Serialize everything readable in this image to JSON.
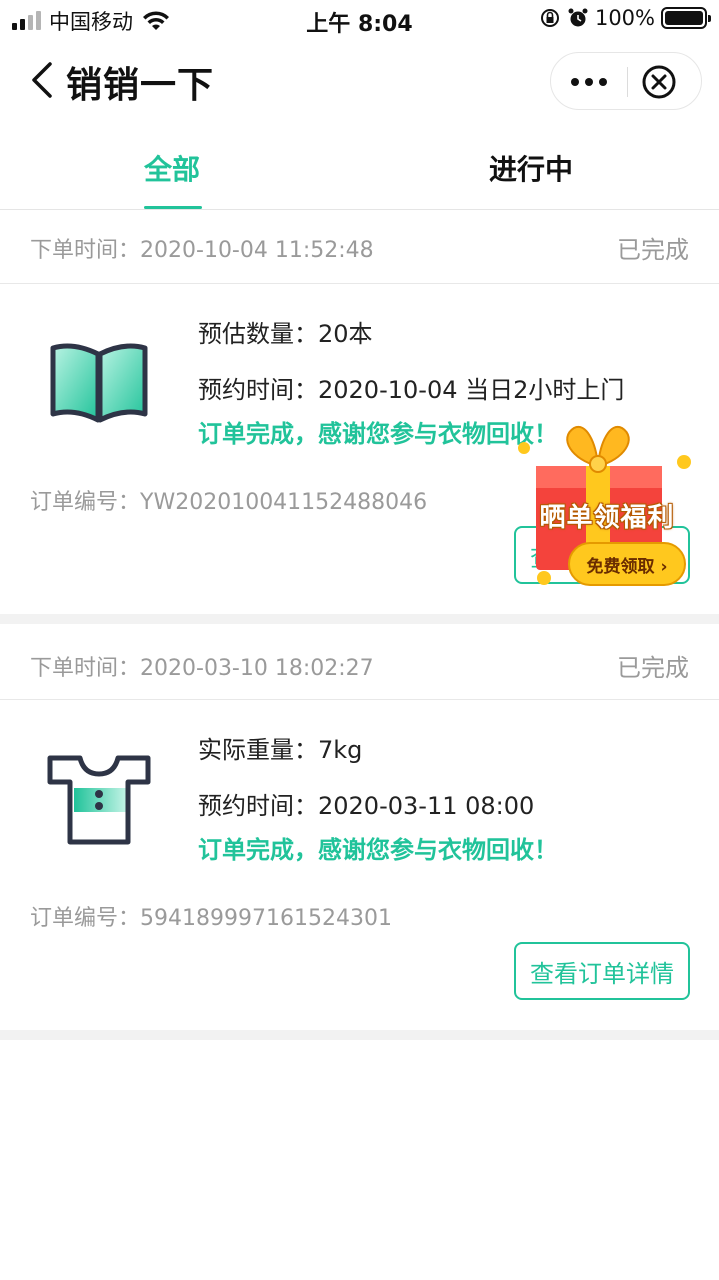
{
  "status_bar": {
    "carrier": "中国移动",
    "time": "上午 8:04",
    "battery": "100%",
    "signal_bars": 4,
    "signal_bars_active": 2
  },
  "nav": {
    "back_icon": "chevron-left-icon",
    "title": "销销一下",
    "more_icon": "more-dots-icon",
    "close_icon": "close-circle-icon"
  },
  "tabs": [
    {
      "label": "全部",
      "active": true
    },
    {
      "label": "进行中",
      "active": false
    }
  ],
  "orders": [
    {
      "time_label": "下单时间：",
      "time": "2020-10-04 11:52:48",
      "status": "已完成",
      "icon": "book-icon",
      "lines": [
        {
          "label": "预估数量：",
          "value": "20本"
        },
        {
          "label": "预约时间：",
          "value": "2020-10-04 当日2小时上门"
        }
      ],
      "message": "订单完成，感谢您参与衣物回收！",
      "order_no_label": "订单编号：",
      "order_no": "YW202010041152488046",
      "button": "查看订单详情"
    },
    {
      "time_label": "下单时间：",
      "time": "2020-03-10 18:02:27",
      "status": "已完成",
      "icon": "tshirt-icon",
      "lines": [
        {
          "label": "实际重量：",
          "value": "7kg"
        },
        {
          "label": "预约时间：",
          "value": "2020-03-11 08:00"
        }
      ],
      "message": "订单完成，感谢您参与衣物回收！",
      "order_no_label": "订单编号：",
      "order_no": "594189997161524301",
      "button": "查看订单详情"
    }
  ],
  "gift_popup": {
    "icon": "gift-box-icon",
    "title": "晒单领福利",
    "cta": "免费领取 ›"
  },
  "colors": {
    "accent": "#21c39a",
    "muted_text": "#9a9a9a",
    "gift_red": "#f4433c",
    "gift_gold": "#ffc81e"
  }
}
